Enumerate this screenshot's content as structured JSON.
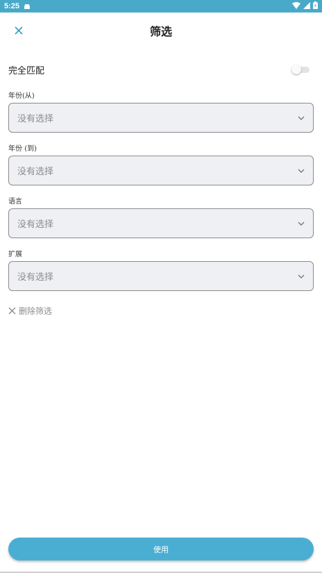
{
  "status_bar": {
    "time": "5:25",
    "bg_color": "#49a9c9",
    "icons": [
      "android-notification-icon",
      "wifi-icon",
      "signal-icon",
      "battery-icon"
    ]
  },
  "header": {
    "title": "筛选",
    "close_icon": "close-icon",
    "accent_color": "#2f9fc4"
  },
  "toggle": {
    "label": "完全匹配",
    "state": "off"
  },
  "fields": [
    {
      "label": "年份(从)",
      "value": "没有选择"
    },
    {
      "label": "年份 (到)",
      "value": "没有选择"
    },
    {
      "label": "语言",
      "value": "没有选择"
    },
    {
      "label": "扩展",
      "value": "没有选择"
    }
  ],
  "clear": {
    "label": "删除筛选",
    "icon": "close-icon"
  },
  "apply": {
    "label": "使用",
    "color": "#4aaed3"
  }
}
